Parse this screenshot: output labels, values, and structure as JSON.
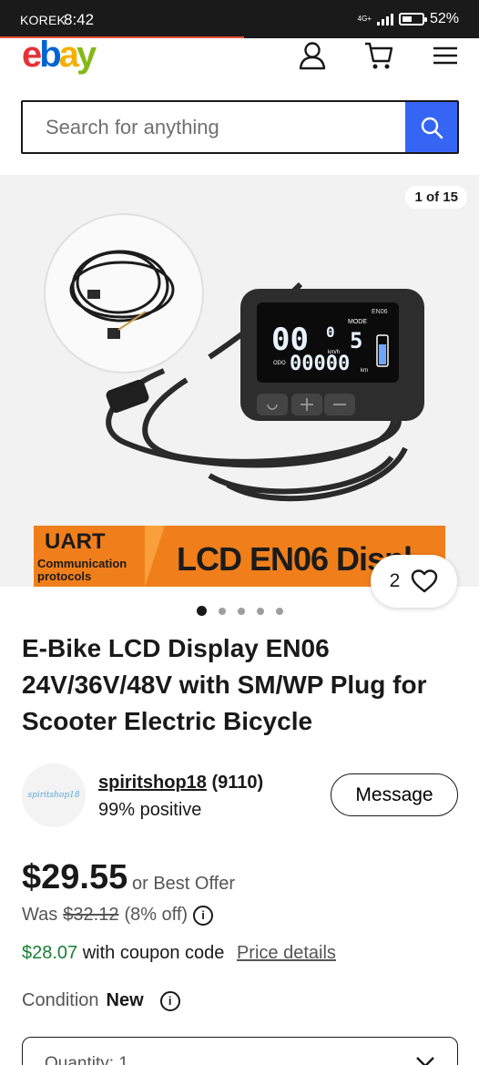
{
  "status_bar": {
    "carrier": "KOREK",
    "time": "8:42",
    "network": "4G+",
    "battery": "52%",
    "battery_level": 0.52
  },
  "header": {
    "logo": {
      "e": "e",
      "b": "b",
      "a": "a",
      "y": "y"
    },
    "icons": [
      "account-icon",
      "cart-icon",
      "menu-icon"
    ]
  },
  "search": {
    "placeholder": "Search for anything",
    "value": ""
  },
  "gallery": {
    "counter": "1 of 15",
    "banner": {
      "uart": "UART",
      "protocols_line1": "Communication",
      "protocols_line2": "protocols",
      "title": "LCD EN06 Displ"
    },
    "lcd": {
      "model": "EN06",
      "speed": "00",
      "speed_decimal": "0",
      "mode_label": "MODE",
      "mode": "5",
      "unit": "km/h",
      "odo_label": "ODO",
      "odo": "00000",
      "odo_unit": "km"
    },
    "watch_count": "2",
    "dots_total": 5,
    "dots_active": 0
  },
  "product": {
    "title": "E-Bike LCD Display EN06 24V/36V/48V with SM/WP Plug for Scooter Electric Bicycle"
  },
  "seller": {
    "avatar_text": "spiritshop18",
    "name": "spiritshop18",
    "count": "(9110)",
    "feedback": "99% positive",
    "message_label": "Message"
  },
  "pricing": {
    "price": "$29.55",
    "best_offer": "or Best Offer",
    "was_label": "Was",
    "was_price": "$32.12",
    "discount": "(8% off)",
    "coupon_price": "$28.07",
    "coupon_text": "with coupon code",
    "details_link": "Price details"
  },
  "condition": {
    "label": "Condition",
    "value": "New"
  },
  "quantity": {
    "label": "Quantity: 1"
  },
  "colors": {
    "accent": "#3665f3",
    "coupon": "#1a7f37",
    "banner": "#f07f1b"
  }
}
